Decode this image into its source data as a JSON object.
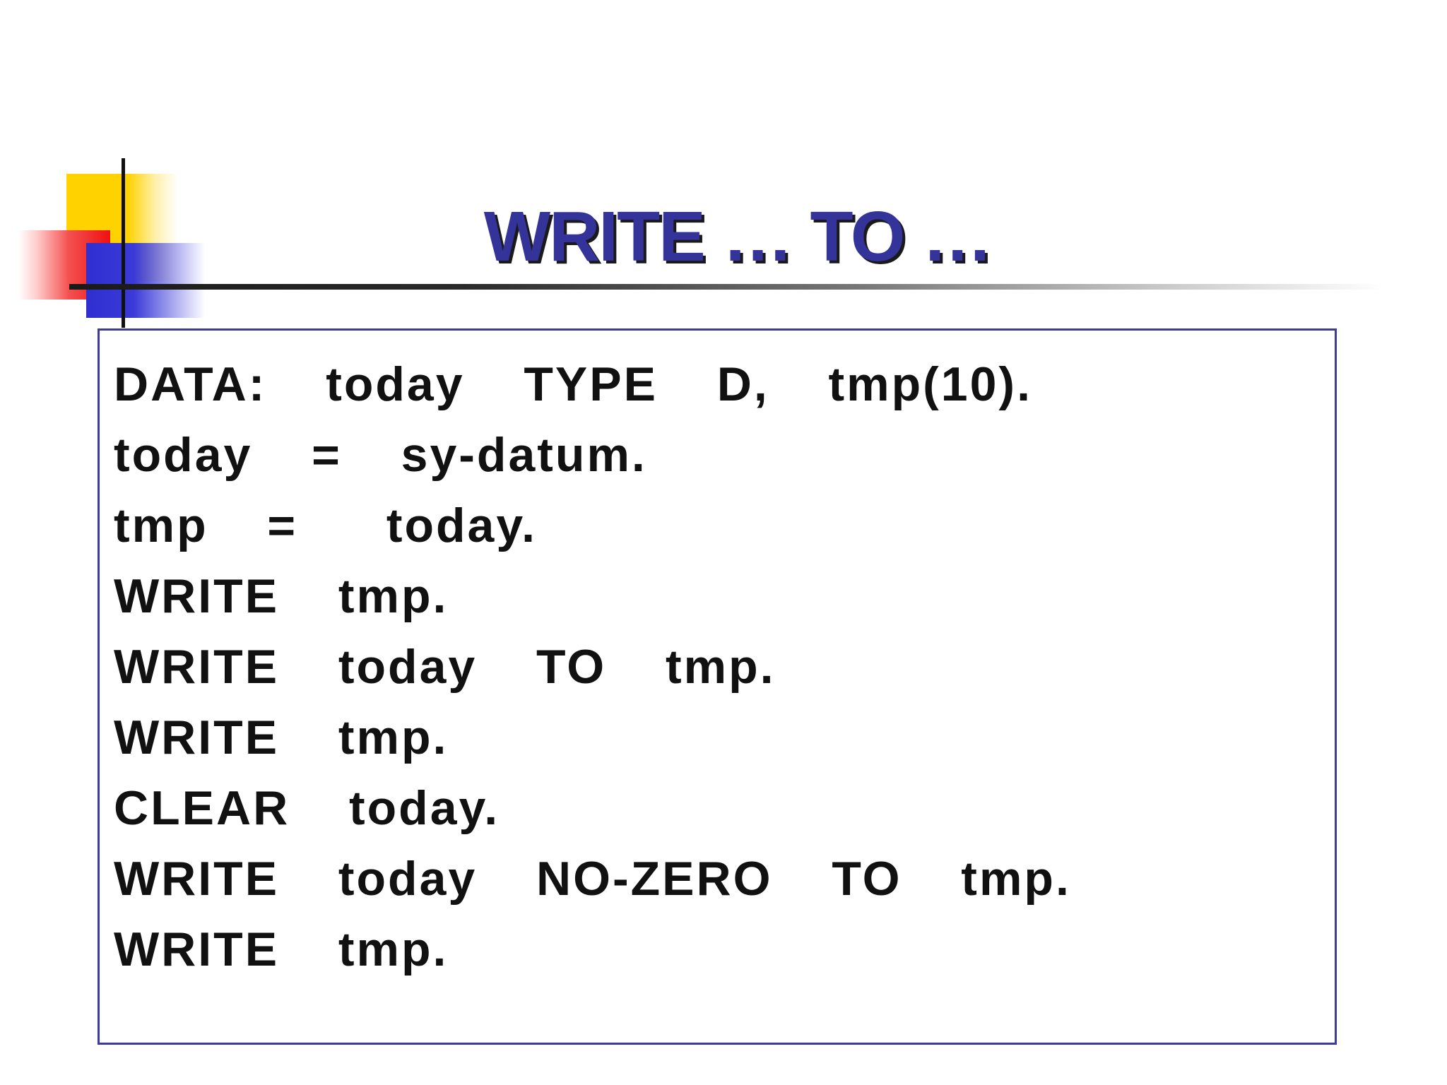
{
  "slide": {
    "title": "WRITE … TO …",
    "code_lines": [
      "DATA:  today  TYPE  D,  tmp(10).",
      "today  =  sy-datum.",
      "tmp  =   today.",
      "WRITE  tmp.",
      "WRITE  today  TO  tmp.",
      "WRITE  tmp.",
      "CLEAR  today.",
      "WRITE  today  NO-ZERO  TO  tmp.",
      "WRITE  tmp."
    ]
  },
  "colors": {
    "title": "#333399",
    "box_border": "#3c3c9e",
    "code_text": "#111111",
    "deco_yellow": "#ffd200",
    "deco_red": "#ee1111",
    "deco_blue": "#2f2fd0"
  }
}
